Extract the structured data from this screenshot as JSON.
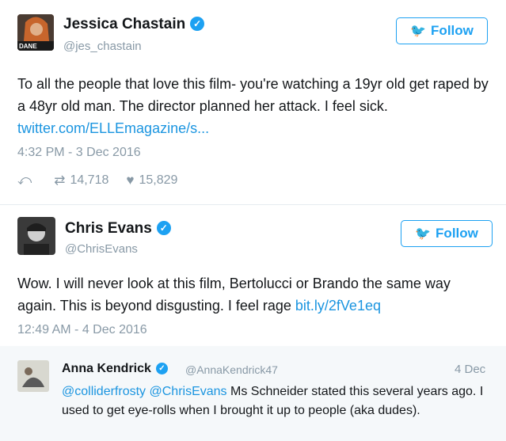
{
  "tweets": [
    {
      "name": "Jessica Chastain",
      "handle": "@jes_chastain",
      "avatar_label": "DANE",
      "follow_label": "Follow",
      "text_before": "To all the people that love this film- you're watching a 19yr old get raped by a 48yr old man. The director planned her attack. I feel sick. ",
      "link": "twitter.com/ELLEmagazine/s...",
      "timestamp": "4:32 PM - 3 Dec 2016",
      "retweets": "14,718",
      "likes": "15,829"
    },
    {
      "name": "Chris Evans",
      "handle": "@ChrisEvans",
      "follow_label": "Follow",
      "text_before": "Wow. I will never look at this film, Bertolucci or Brando the same way again. This is beyond disgusting. I feel rage ",
      "link": "bit.ly/2fVe1eq",
      "timestamp": "12:49 AM - 4 Dec 2016"
    }
  ],
  "reply": {
    "name": "Anna Kendrick",
    "handle": "@AnnaKendrick47",
    "date": "4 Dec",
    "mention1": "@colliderfrosty",
    "mention2": "@ChrisEvans",
    "text": " Ms Schneider stated this several years ago. I used to get eye-rolls when I brought it up to people (aka dudes)."
  },
  "colors": {
    "accent": "#1da1f2",
    "link": "#1b95e0",
    "muted": "#8899a6"
  },
  "icons": [
    "verified-badge-icon",
    "twitter-bird-icon",
    "reply-icon",
    "retweet-icon",
    "heart-icon"
  ]
}
